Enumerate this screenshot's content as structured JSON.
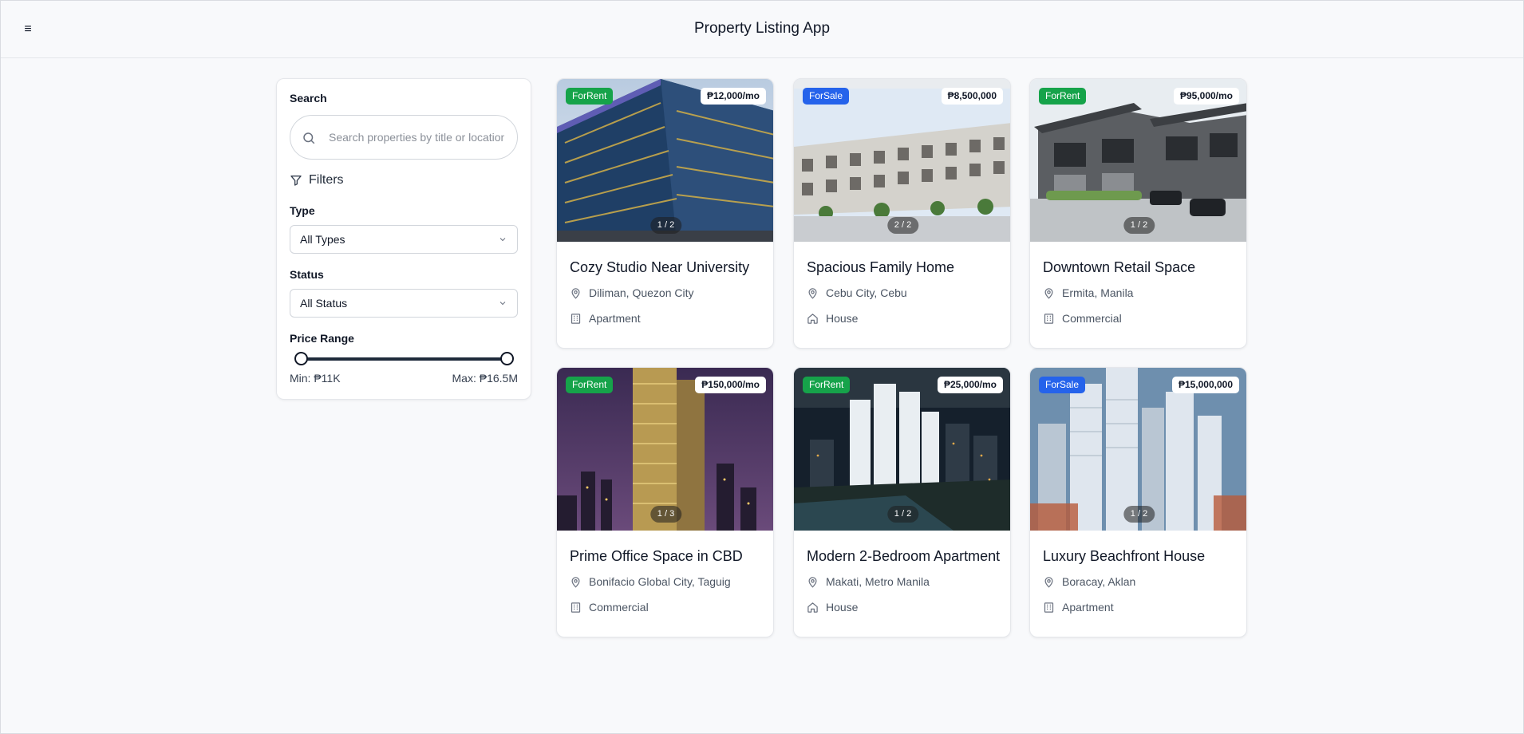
{
  "header": {
    "menu_glyph": "≡",
    "title": "Property Listing App"
  },
  "sidebar": {
    "search_label": "Search",
    "search_placeholder": "Search properties by title or location",
    "filters_label": "Filters",
    "type_label": "Type",
    "type_value": "All Types",
    "status_label": "Status",
    "status_value": "All Status",
    "price_label": "Price Range",
    "min_text": "Min: ₱11K",
    "max_text": "Max: ₱16.5M",
    "range_fraction": [
      0,
      1
    ]
  },
  "colors": {
    "for_rent": "#16a34a",
    "for_sale": "#2563eb"
  },
  "listings": [
    {
      "status": "ForRent",
      "price": "₱12,000/mo",
      "counter": "1 / 2",
      "title": "Cozy Studio Near University",
      "location": "Diliman, Quezon City",
      "type": "Apartment",
      "type_icon": "building-icon"
    },
    {
      "status": "ForSale",
      "price": "₱8,500,000",
      "counter": "2 / 2",
      "title": "Spacious Family Home",
      "location": "Cebu City, Cebu",
      "type": "House",
      "type_icon": "house-icon"
    },
    {
      "status": "ForRent",
      "price": "₱95,000/mo",
      "counter": "1 / 2",
      "title": "Downtown Retail Space",
      "location": "Ermita, Manila",
      "type": "Commercial",
      "type_icon": "building-icon"
    },
    {
      "status": "ForRent",
      "price": "₱150,000/mo",
      "counter": "1 / 3",
      "title": "Prime Office Space in CBD",
      "location": "Bonifacio Global City, Taguig",
      "type": "Commercial",
      "type_icon": "building-icon"
    },
    {
      "status": "ForRent",
      "price": "₱25,000/mo",
      "counter": "1 / 2",
      "title": "Modern 2-Bedroom Apartment",
      "location": "Makati, Metro Manila",
      "type": "House",
      "type_icon": "house-icon"
    },
    {
      "status": "ForSale",
      "price": "₱15,000,000",
      "counter": "1 / 2",
      "title": "Luxury Beachfront House",
      "location": "Boracay, Aklan",
      "type": "Apartment",
      "type_icon": "building-icon"
    }
  ]
}
